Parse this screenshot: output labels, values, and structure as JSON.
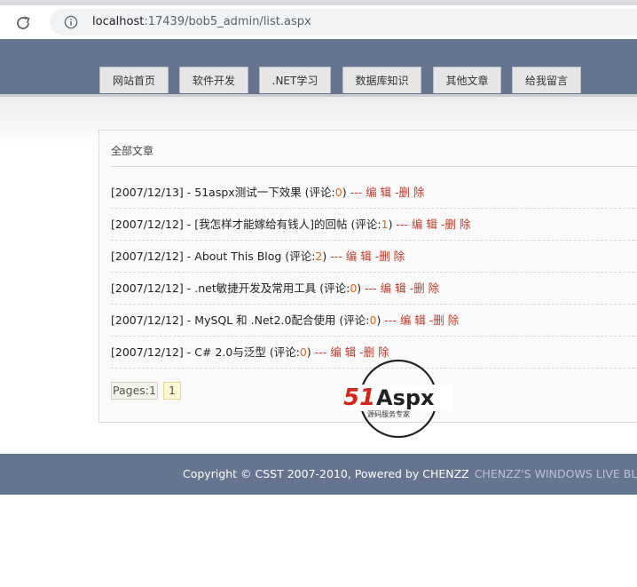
{
  "browser": {
    "url_host": "localhost",
    "url_rest": ":17439/bob5_admin/list.aspx"
  },
  "nav": {
    "items": [
      {
        "label": "网站首页"
      },
      {
        "label": "软件开发"
      },
      {
        "label": ".NET学习"
      },
      {
        "label": "数据库知识"
      },
      {
        "label": "其他文章"
      },
      {
        "label": "给我留言"
      }
    ]
  },
  "panel": {
    "title": "全部文章",
    "articles": [
      {
        "date": "[2007/12/13]",
        "title": "51aspx测试一下效果",
        "comments": "0"
      },
      {
        "date": "[2007/12/12]",
        "title": "[我怎样才能嫁给有钱人]的回帖",
        "comments": "1"
      },
      {
        "date": "[2007/12/12]",
        "title": "About This Blog",
        "comments": "2"
      },
      {
        "date": "[2007/12/12]",
        "title": ".net敏捷开发及常用工具",
        "comments": "0"
      },
      {
        "date": "[2007/12/12]",
        "title": "MySQL 和 .Net2.0配合使用",
        "comments": "0"
      },
      {
        "date": "[2007/12/12]",
        "title": "C# 2.0与泛型",
        "comments": "0"
      }
    ],
    "comment_prefix": " (评论:",
    "comment_suffix": ")",
    "edit_label": " --- 编 辑",
    "delete_label": " -删 除",
    "pager_label": "Pages:1",
    "pager_current": "1"
  },
  "watermark": {
    "brand": "51Aspx",
    "tagline": "源码服务专家"
  },
  "footer": {
    "copyright": "Copyright © CSST 2007-2010, Powered by CHENZZ",
    "live": "CHENZZ'S WINDOWS LIVE BLOG"
  },
  "colors": {
    "header_bg": "#66758f",
    "comment_count": "#e0691a",
    "action_link": "#c0392b"
  }
}
